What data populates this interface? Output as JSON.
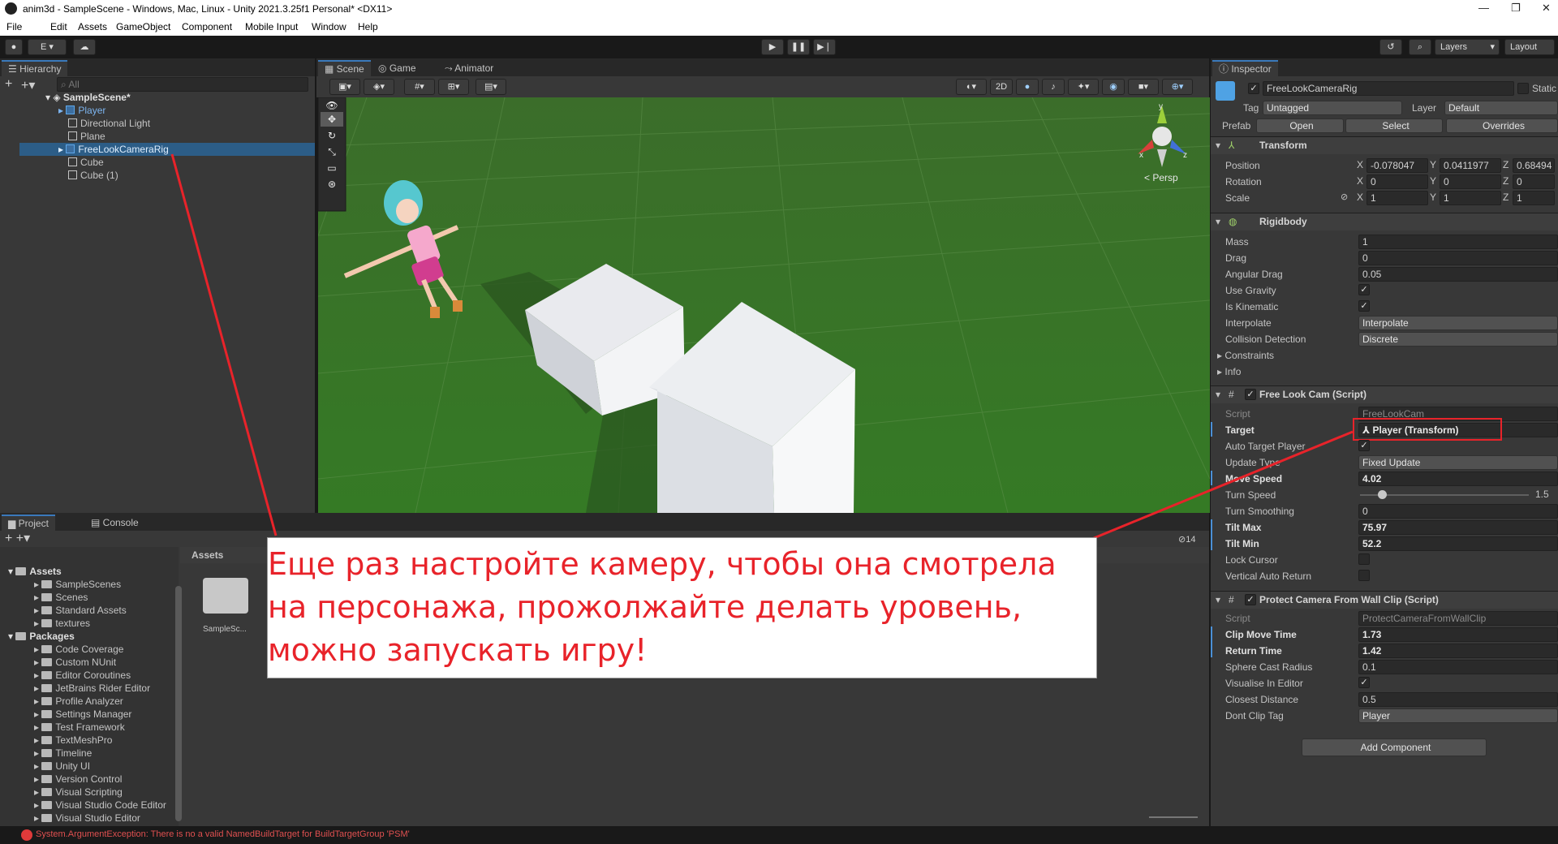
{
  "window": {
    "title": "anim3d - SampleScene - Windows, Mac, Linux - Unity 2021.3.25f1 Personal* <DX11>"
  },
  "menu": [
    "File",
    "Edit",
    "Assets",
    "GameObject",
    "Component",
    "Mobile Input",
    "Window",
    "Help"
  ],
  "toolbar": {
    "account": "E",
    "layers": "Layers",
    "layout": "Layout"
  },
  "hierarchy": {
    "tab": "Hierarchy",
    "search_placeholder": "All",
    "scene": "SampleScene*",
    "items": [
      {
        "label": "Player"
      },
      {
        "label": "Directional Light"
      },
      {
        "label": "Plane"
      },
      {
        "label": "FreeLookCameraRig"
      },
      {
        "label": "Cube"
      },
      {
        "label": "Cube (1)"
      }
    ]
  },
  "scene_view": {
    "tabs": [
      "Scene",
      "Game",
      "Animator"
    ],
    "mode_2d": "2D",
    "persp": "< Persp",
    "gizmo": {
      "y": "y",
      "x": "x",
      "z": "z"
    }
  },
  "project": {
    "tabs": [
      "Project",
      "Console"
    ],
    "breadcrumb": "Assets",
    "count": "14",
    "tree": [
      {
        "label": "Assets",
        "bold": true,
        "depth": 0
      },
      {
        "label": "SampleScenes",
        "depth": 1
      },
      {
        "label": "Scenes",
        "depth": 1
      },
      {
        "label": "Standard Assets",
        "depth": 1
      },
      {
        "label": "textures",
        "depth": 1
      },
      {
        "label": "Packages",
        "bold": true,
        "depth": 0
      },
      {
        "label": "Code Coverage",
        "depth": 1
      },
      {
        "label": "Custom NUnit",
        "depth": 1
      },
      {
        "label": "Editor Coroutines",
        "depth": 1
      },
      {
        "label": "JetBrains Rider Editor",
        "depth": 1
      },
      {
        "label": "Profile Analyzer",
        "depth": 1
      },
      {
        "label": "Settings Manager",
        "depth": 1
      },
      {
        "label": "Test Framework",
        "depth": 1
      },
      {
        "label": "TextMeshPro",
        "depth": 1
      },
      {
        "label": "Timeline",
        "depth": 1
      },
      {
        "label": "Unity UI",
        "depth": 1
      },
      {
        "label": "Version Control",
        "depth": 1
      },
      {
        "label": "Visual Scripting",
        "depth": 1
      },
      {
        "label": "Visual Studio Code Editor",
        "depth": 1
      },
      {
        "label": "Visual Studio Editor",
        "depth": 1
      }
    ],
    "asset": "SampleSc..."
  },
  "inspector": {
    "tab": "Inspector",
    "object_name": "FreeLookCameraRig",
    "static": "Static",
    "tag_label": "Tag",
    "tag": "Untagged",
    "layer_label": "Layer",
    "layer": "Default",
    "prefab_label": "Prefab",
    "prefab_open": "Open",
    "prefab_select": "Select",
    "prefab_overrides": "Overrides",
    "transform": {
      "title": "Transform",
      "position": "Position",
      "rotation": "Rotation",
      "scale": "Scale",
      "pos": [
        "-0.078047",
        "0.0411977",
        "0.68494"
      ],
      "rot": [
        "0",
        "0",
        "0"
      ],
      "scl": [
        "1",
        "1",
        "1"
      ]
    },
    "rigidbody": {
      "title": "Rigidbody",
      "fields": [
        {
          "label": "Mass",
          "value": "1"
        },
        {
          "label": "Drag",
          "value": "0"
        },
        {
          "label": "Angular Drag",
          "value": "0.05"
        }
      ],
      "use_gravity": "Use Gravity",
      "is_kinematic": "Is Kinematic",
      "interpolate": "Interpolate",
      "interpolate_val": "Interpolate",
      "collision": "Collision Detection",
      "collision_val": "Discrete",
      "constraints": "Constraints",
      "info": "Info"
    },
    "freelook": {
      "title": "Free Look Cam (Script)",
      "script_label": "Script",
      "script_val": "FreeLookCam",
      "target_label": "Target",
      "target_val": "Player (Transform)",
      "auto_target": "Auto Target Player",
      "update_type": "Update Type",
      "update_val": "Fixed Update",
      "move_speed": "Move Speed",
      "move_val": "4.02",
      "turn_speed": "Turn Speed",
      "turn_val": "1.5",
      "turn_fraction": 0.13,
      "turn_smoothing": "Turn Smoothing",
      "turn_smooth_val": "0",
      "tilt_max": "Tilt Max",
      "tilt_max_val": "75.97",
      "tilt_min": "Tilt Min",
      "tilt_min_val": "52.2",
      "lock_cursor": "Lock Cursor",
      "vertical_return": "Vertical Auto Return"
    },
    "protect": {
      "title": "Protect Camera From Wall Clip (Script)",
      "script_label": "Script",
      "script_val": "ProtectCameraFromWallClip",
      "fields": [
        {
          "label": "Clip Move Time",
          "value": "1.73",
          "bold": true
        },
        {
          "label": "Return Time",
          "value": "1.42",
          "bold": true
        },
        {
          "label": "Sphere Cast Radius",
          "value": "0.1"
        }
      ],
      "visualise": "Visualise In Editor",
      "closest": "Closest Distance",
      "closest_val": "0.5",
      "dont_clip": "Dont Clip Tag",
      "dont_clip_val": "Player"
    },
    "add_component": "Add Component"
  },
  "overlay": {
    "text": "Еще раз настройте камеру, чтобы она смотрела на персонажа, прожолжайте делать уровень, можно запускать игру!"
  },
  "status": {
    "error": "System.ArgumentException: There is no a valid NamedBuildTarget for BuildTargetGroup 'PSM'"
  },
  "colors": {
    "accent": "#3a79bb",
    "annotation": "#e8232a",
    "ground": "#3f7a2e"
  }
}
